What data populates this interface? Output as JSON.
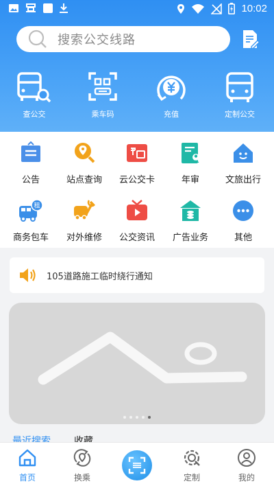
{
  "status_bar": {
    "time": "10:02"
  },
  "search": {
    "placeholder": "搜索公交线路"
  },
  "quick_actions": [
    {
      "label": "查公交",
      "icon": "bus-search-icon"
    },
    {
      "label": "乘车码",
      "icon": "qr-code-icon"
    },
    {
      "label": "充值",
      "icon": "yuan-recharge-icon"
    },
    {
      "label": "定制公交",
      "icon": "bus-icon"
    }
  ],
  "services_row1": [
    {
      "label": "公告",
      "icon": "announcement-icon",
      "color": "#4a8fe8"
    },
    {
      "label": "站点查询",
      "icon": "location-search-icon",
      "color": "#f2a31b"
    },
    {
      "label": "云公交卡",
      "icon": "bus-card-icon",
      "color": "#ee4d45"
    },
    {
      "label": "年审",
      "icon": "annual-review-icon",
      "color": "#1fb8a6"
    },
    {
      "label": "文旅出行",
      "icon": "travel-house-icon",
      "color": "#3b8fe8"
    }
  ],
  "services_row2": [
    {
      "label": "商务包车",
      "icon": "charter-bus-icon",
      "color": "#3b8fe8",
      "badge": "租"
    },
    {
      "label": "对外维修",
      "icon": "repair-icon",
      "color": "#f2a31b"
    },
    {
      "label": "公交资讯",
      "icon": "tv-news-icon",
      "color": "#ee4d45"
    },
    {
      "label": "广告业务",
      "icon": "ad-house-icon",
      "color": "#1fb8a6"
    },
    {
      "label": "其他",
      "icon": "more-icon",
      "color": "#3b8fe8"
    }
  ],
  "notice": {
    "text": "105道路施工临时绕行通知",
    "icon": "speaker-icon"
  },
  "banner": {
    "total_slides": 5,
    "active_index": 4
  },
  "lower_tabs": {
    "recent": "最近搜索",
    "favorites": "收藏"
  },
  "bottom_nav": [
    {
      "label": "首页",
      "icon": "home-icon",
      "active": true
    },
    {
      "label": "换乘",
      "icon": "transfer-icon",
      "active": false
    },
    {
      "label": "定制",
      "icon": "custom-gear-icon",
      "active": false
    },
    {
      "label": "我的",
      "icon": "user-icon",
      "active": false
    }
  ],
  "colors": {
    "primary": "#2f8ff2",
    "background": "#f2f3f5"
  }
}
